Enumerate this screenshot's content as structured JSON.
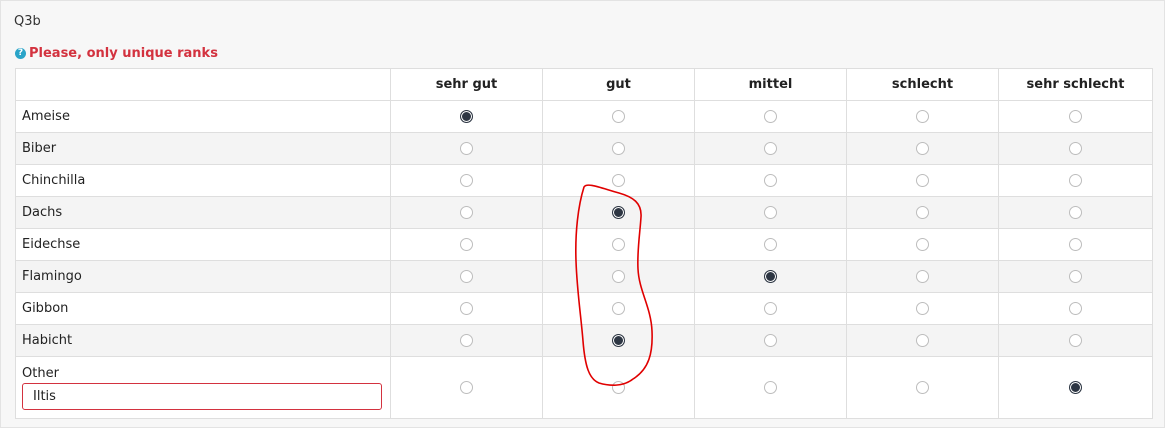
{
  "question_id": "Q3b",
  "tip": {
    "icon": "help-icon",
    "text": "Please, only unique ranks",
    "color": "#d3323f"
  },
  "columns": [
    "sehr gut",
    "gut",
    "mittel",
    "schlecht",
    "sehr schlecht"
  ],
  "rows": [
    {
      "label": "Ameise",
      "selected": 0
    },
    {
      "label": "Biber",
      "selected": null
    },
    {
      "label": "Chinchilla",
      "selected": null
    },
    {
      "label": "Dachs",
      "selected": 1
    },
    {
      "label": "Eidechse",
      "selected": null
    },
    {
      "label": "Flamingo",
      "selected": 2
    },
    {
      "label": "Gibbon",
      "selected": null
    },
    {
      "label": "Habicht",
      "selected": 1
    }
  ],
  "other": {
    "label": "Other",
    "value": "Iltis",
    "selected": 4
  },
  "annotation": {
    "type": "hand-drawn-outline",
    "color": "#e00000",
    "target_column": "gut"
  }
}
